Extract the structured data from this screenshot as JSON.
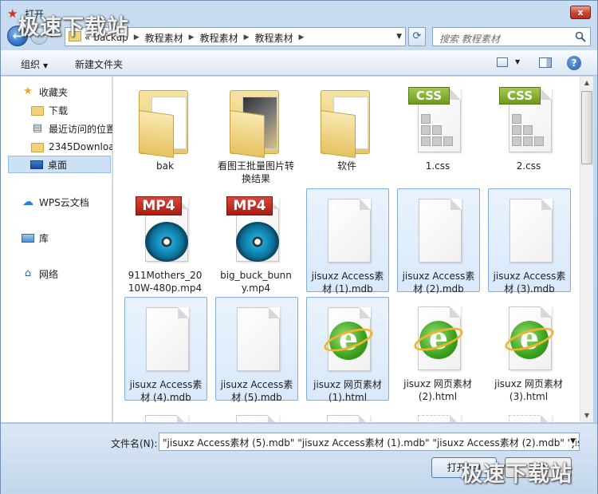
{
  "window": {
    "title": "打开",
    "close_label": "x"
  },
  "watermark": {
    "text": "极速下载站"
  },
  "address": {
    "crumbs": [
      "«",
      "backup",
      "教程素材",
      "教程素材",
      "教程素材"
    ],
    "search_placeholder": "搜索 教程素材"
  },
  "toolbar": {
    "organize": "组织",
    "new_folder": "新建文件夹"
  },
  "sidebar": {
    "items": [
      {
        "label": "收藏夹",
        "icon": "star-icon"
      },
      {
        "label": "下载",
        "icon": "folder-icon"
      },
      {
        "label": "最近访问的位置",
        "icon": "recent-icon"
      },
      {
        "label": "2345Downloads",
        "icon": "folder-icon"
      },
      {
        "label": "桌面",
        "icon": "desktop-icon"
      },
      {
        "label": "WPS云文档",
        "icon": "cloud-icon"
      },
      {
        "label": "库",
        "icon": "library-icon"
      },
      {
        "label": "网络",
        "icon": "network-icon"
      }
    ]
  },
  "files": [
    {
      "name": "bak",
      "type": "folder"
    },
    {
      "name": "看图王批量图片转换结果",
      "type": "folder-image"
    },
    {
      "name": "软件",
      "type": "folder"
    },
    {
      "name": "1.css",
      "type": "css"
    },
    {
      "name": "2.css",
      "type": "css"
    },
    {
      "name": "911Mothers_2010W-480p.mp4",
      "type": "mp4"
    },
    {
      "name": "big_buck_bunny.mp4",
      "type": "mp4"
    },
    {
      "name": "jisuxz Access素材 (1).mdb",
      "type": "mdb",
      "selected": true
    },
    {
      "name": "jisuxz Access素材 (2).mdb",
      "type": "mdb",
      "selected": true
    },
    {
      "name": "jisuxz Access素材 (3).mdb",
      "type": "mdb",
      "selected": true
    },
    {
      "name": "jisuxz Access素材 (4).mdb",
      "type": "mdb",
      "selected": true
    },
    {
      "name": "jisuxz Access素材 (5).mdb",
      "type": "mdb",
      "selected": true
    },
    {
      "name": "jisuxz 网页素材 (1).html",
      "type": "html",
      "selected": true
    },
    {
      "name": "jisuxz 网页素材 (2).html",
      "type": "html"
    },
    {
      "name": "jisuxz 网页素材 (3).html",
      "type": "html"
    }
  ],
  "footer": {
    "filename_label": "文件名(N):",
    "filename_value": "\"jisuxz Access素材 (5).mdb\" \"jisuxz Access素材 (1).mdb\" \"jisuxz Access素材 (2).mdb\" \"jisu",
    "open_label": "打开(O)",
    "cancel_label": "取消"
  }
}
